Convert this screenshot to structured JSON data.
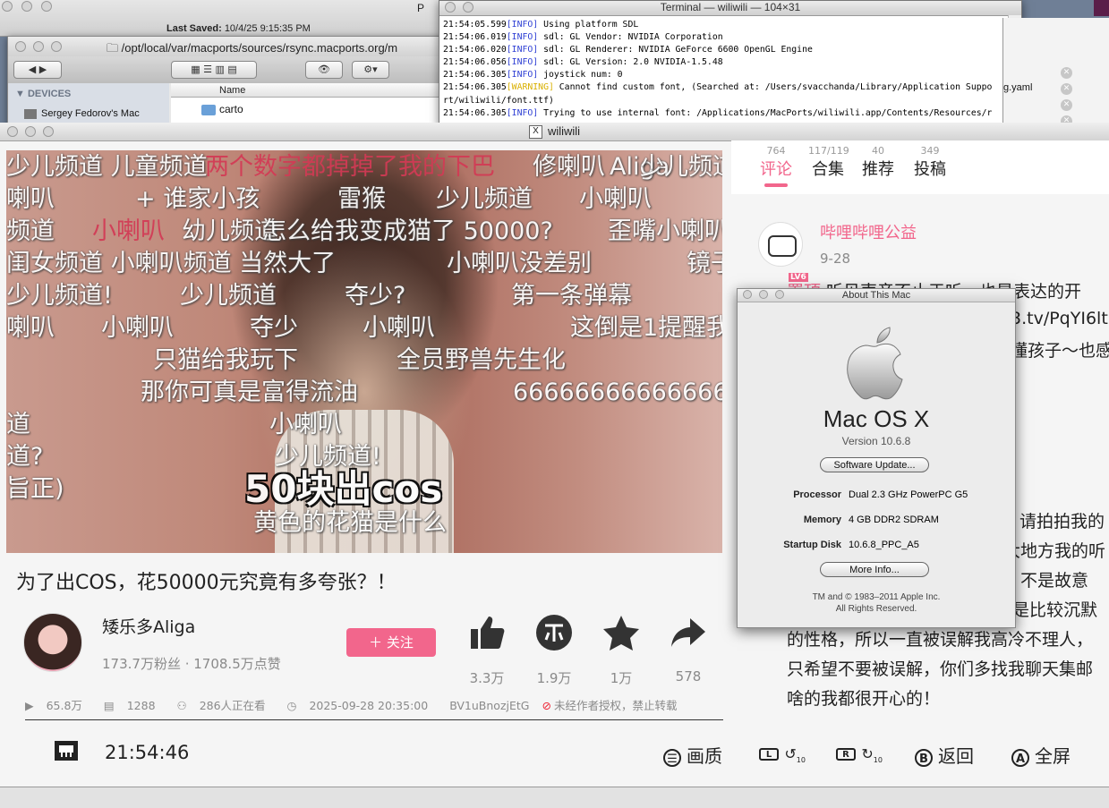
{
  "editor": {
    "saved_label": "Last Saved:",
    "saved_value": "10/4/25 9:15:35 PM",
    "partial_title": "P"
  },
  "finder": {
    "path": "/opt/local/var/macports/sources/rsync.macports.org/m",
    "devices_header": "DEVICES",
    "device": "Sergey Fedorov's Mac",
    "column_name": "Name",
    "row": "carto"
  },
  "terminal": {
    "title": "Terminal — wiliwili — 104×31",
    "lines": [
      {
        "time": "21:54:05.599",
        "tag": "[INFO]",
        "msg": " Using platform SDL"
      },
      {
        "time": "21:54:06.019",
        "tag": "[INFO]",
        "msg": " sdl: GL Vendor: NVIDIA Corporation"
      },
      {
        "time": "21:54:06.020",
        "tag": "[INFO]",
        "msg": " sdl: GL Renderer: NVIDIA GeForce 6600 OpenGL Engine"
      },
      {
        "time": "21:54:06.056",
        "tag": "[INFO]",
        "msg": " sdl: GL Version: 2.0 NVIDIA-1.5.48"
      },
      {
        "time": "21:54:06.305",
        "tag": "[INFO]",
        "msg": " joystick num: 0"
      },
      {
        "time": "21:54:06.305",
        "tag": "[WARNING]",
        "msg": " Cannot find custom font, (Searched at: /Users/svacchanda/Library/Application Suppo"
      },
      {
        "time": "",
        "tag": "",
        "msg": "rt/wiliwili/font.ttf)"
      },
      {
        "time": "21:54:06.305",
        "tag": "[INFO]",
        "msg": " Trying to use internal font: /Applications/MacPorts/wiliwili.app/Contents/Resources/r"
      }
    ]
  },
  "yaml": {
    "filename": "g.yaml"
  },
  "wiliwili": {
    "title": "wiliwili",
    "danmaku": [
      {
        "t": "少儿频道  儿童频道",
        "red": false
      },
      {
        "t": "两个数字都掉掉了我的下巴",
        "red": true
      },
      {
        "t": "修喇叭",
        "red": false
      },
      {
        "t": "Aliga",
        "red": false
      },
      {
        "t": "少儿频道",
        "red": false
      },
      {
        "t": "喇叭",
        "red": false
      },
      {
        "t": "+   谁家小孩",
        "red": false
      },
      {
        "t": "雷猴",
        "red": false
      },
      {
        "t": "少儿频道",
        "red": false
      },
      {
        "t": "小喇叭",
        "red": false
      },
      {
        "t": "频道",
        "red": false
      },
      {
        "t": "小喇叭",
        "red": true
      },
      {
        "t": "幼儿频道",
        "red": false
      },
      {
        "t": "怎么给我变成猫了 50000?",
        "red": false
      },
      {
        "t": "歪嘴小喇叭",
        "red": false
      },
      {
        "t": "闺女频道  小喇叭频道  当然大了",
        "red": false
      },
      {
        "t": "小喇叭没差别",
        "red": false
      },
      {
        "t": "镜子",
        "red": false
      },
      {
        "t": "少儿频道!",
        "red": false
      },
      {
        "t": "少儿频道",
        "red": false
      },
      {
        "t": "夺少?",
        "red": false
      },
      {
        "t": "第一条弹幕",
        "red": false
      },
      {
        "t": "喇叭",
        "red": false
      },
      {
        "t": "小喇叭",
        "red": false
      },
      {
        "t": "夺少",
        "red": false
      },
      {
        "t": "小喇叭",
        "red": false
      },
      {
        "t": "这倒是1提醒我",
        "red": false
      },
      {
        "t": "只猫给我玩下",
        "red": false
      },
      {
        "t": "全员野兽先生化",
        "red": false
      },
      {
        "t": "那你可真是富得流油",
        "red": false
      },
      {
        "t": "66666666666666",
        "red": false
      },
      {
        "t": "小喇叭",
        "red": false
      },
      {
        "t": "道",
        "red": false
      },
      {
        "t": "少儿频道!",
        "red": false
      },
      {
        "t": "道?",
        "red": false
      },
      {
        "t": "旨正)",
        "red": false
      },
      {
        "t": "50块出cos",
        "red": false
      },
      {
        "t": "黄色的花猫是什么",
        "red": false
      }
    ],
    "video_title": "为了出COS，花50000元究竟有多夸张？！",
    "uploader": {
      "name": "矮乐多Aliga",
      "stats": "173.7万粉丝 · 1708.5万点赞",
      "follow": "＋ 关注"
    },
    "actions": [
      {
        "name": "like",
        "count": "3.3万"
      },
      {
        "name": "coin",
        "count": "1.9万"
      },
      {
        "name": "favorite",
        "count": "1万"
      },
      {
        "name": "share",
        "count": "578"
      }
    ],
    "meta": {
      "views": "65.8万",
      "danmaku": "1288",
      "watching": "286人正在看",
      "date": "2025-09-28 20:35:00",
      "bvid": "BV1uBnozjEtG",
      "notice": "未经作者授权，禁止转载"
    },
    "tabs": [
      {
        "count": "764",
        "label": "评论",
        "active": true
      },
      {
        "count": "117/119",
        "label": "合集",
        "active": false
      },
      {
        "count": "40",
        "label": "推荐",
        "active": false
      },
      {
        "count": "349",
        "label": "投稿",
        "active": false
      }
    ],
    "comment": {
      "user": "哔哩哔哩公益",
      "level": "LV6",
      "date": "9-28",
      "pin": "置顶",
      "lines_top": [
        "听见声音不止于听，也是表达的开",
        "3.tv/PqYI6lt",
        "懂孩子～也感"
      ],
      "lines_bottom": [
        "请拍拍我的",
        "大地方我的听",
        "，不是故意",
        "是比较沉默",
        "的性格，所以一直被误解我高冷不理人，",
        "只希望不要被误解，你们多找我聊天集邮",
        "啥的我都很开心的！"
      ]
    },
    "bottom": {
      "time": "21:54:46",
      "quality": "画质",
      "back": "返回",
      "fullscreen": "全屏",
      "l_key": "L",
      "r_key": "R",
      "b_key": "B",
      "a_key": "A",
      "seek_seconds": "10"
    }
  },
  "about": {
    "title": "About This Mac",
    "os": "Mac OS X",
    "version": "Version 10.6.8",
    "software_update": "Software Update...",
    "specs": [
      {
        "k": "Processor",
        "v": "Dual 2.3 GHz PowerPC G5"
      },
      {
        "k": "Memory",
        "v": "4 GB DDR2 SDRAM"
      },
      {
        "k": "Startup Disk",
        "v": "10.6.8_PPC_A5"
      }
    ],
    "more_info": "More Info...",
    "copyright1": "TM and © 1983–2011 Apple Inc.",
    "copyright2": "All Rights Reserved."
  },
  "colors": {
    "accent": "#f2668c",
    "terminal_info": "#2e3fd4",
    "terminal_warning": "#d9b000"
  }
}
